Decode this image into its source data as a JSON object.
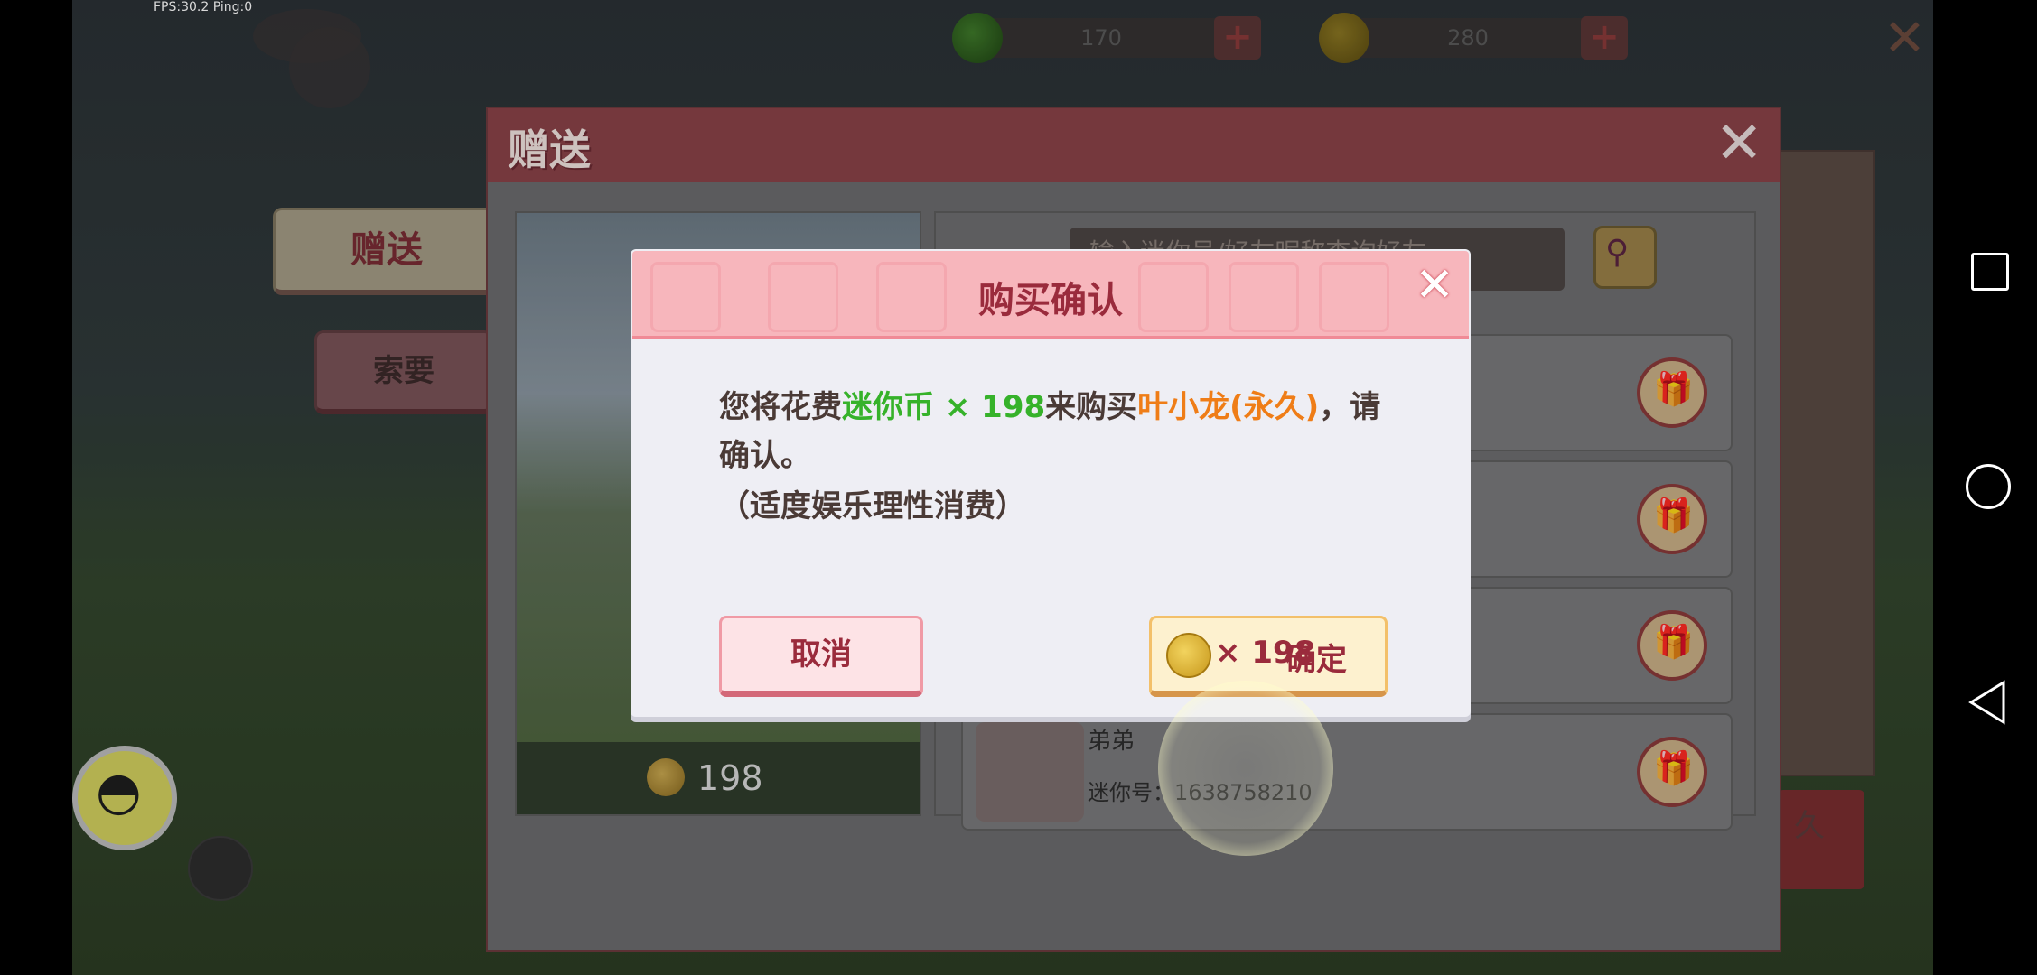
{
  "hud": {
    "fps_text": "FPS:30.2  Ping:0",
    "currency1": {
      "icon": "green-bean-icon",
      "value": "170",
      "plus": "+"
    },
    "currency2": {
      "icon": "mini-coin-icon",
      "value": "280",
      "plus": "+"
    },
    "close_glyph": "✕"
  },
  "panel": {
    "title": "赠送",
    "close_glyph": "✕",
    "tab_send": "赠送",
    "tab_request": "索要",
    "search_placeholder": "输入迷你号/好友昵称查询好友",
    "price": "198",
    "friend": {
      "name": "弟弟",
      "id_label": "迷你号：1638758210"
    }
  },
  "back_panel": {
    "label": "久"
  },
  "dialog": {
    "title": "购买确认",
    "close_glyph": "✕",
    "message_prefix": "您将花费",
    "currency_text": "迷你币 × 198",
    "message_mid": "来购买",
    "item_text": "叶小龙(永久)",
    "message_suffix": "，请确认。",
    "note": "（适度娱乐理性消费）",
    "cancel_label": "取消",
    "confirm_price": "× 198",
    "confirm_label": "确定"
  },
  "colors": {
    "dialog_header": "#f7b6bc",
    "title_text": "#9a2b3c",
    "currency_highlight": "#36b22a",
    "item_highlight": "#ef7d17"
  }
}
